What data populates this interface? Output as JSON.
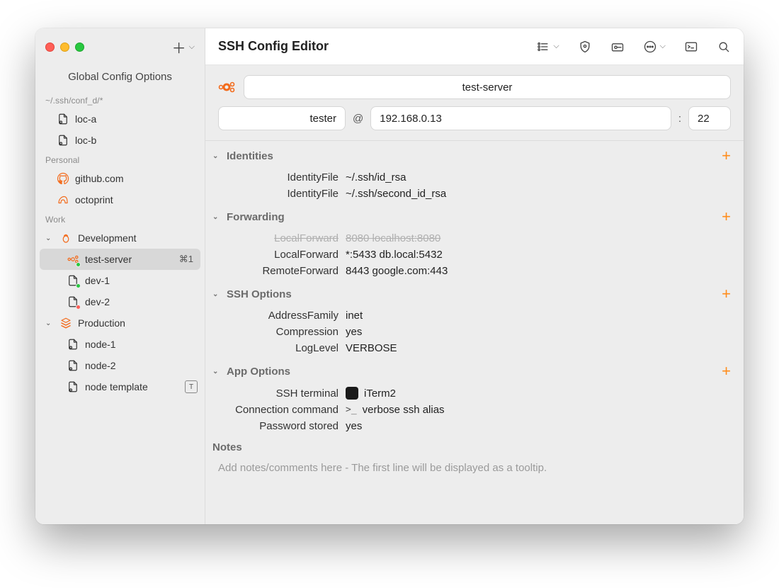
{
  "window": {
    "title": "SSH Config Editor"
  },
  "sidebar": {
    "title": "Global Config Options",
    "groups": [
      {
        "label": "~/.ssh/conf_d/*",
        "items": [
          {
            "label": "loc-a",
            "icon": "file-link"
          },
          {
            "label": "loc-b",
            "icon": "file-link"
          }
        ]
      },
      {
        "label": "Personal",
        "items": [
          {
            "label": "github.com",
            "icon": "github"
          },
          {
            "label": "octoprint",
            "icon": "octoprint"
          }
        ]
      },
      {
        "label": "Work",
        "items": [
          {
            "label": "Development",
            "icon": "bug-orange",
            "expanded": true,
            "children": [
              {
                "label": "test-server",
                "icon": "ubuntu-green",
                "selected": true,
                "shortcut": "⌘1"
              },
              {
                "label": "dev-1",
                "icon": "file-green"
              },
              {
                "label": "dev-2",
                "icon": "file-red"
              }
            ]
          },
          {
            "label": "Production",
            "icon": "stack-orange",
            "expanded": true,
            "children": [
              {
                "label": "node-1",
                "icon": "file-link"
              },
              {
                "label": "node-2",
                "icon": "file-link"
              },
              {
                "label": "node template",
                "icon": "file-link",
                "trailing_badge": "T"
              }
            ]
          }
        ]
      }
    ]
  },
  "host": {
    "name": "test-server",
    "os_icon": "ubuntu",
    "user": "tester",
    "address": "192.168.0.13",
    "port": "22"
  },
  "sections": {
    "identities": {
      "title": "Identities",
      "rows": [
        {
          "key": "IdentityFile",
          "value": "~/.ssh/id_rsa"
        },
        {
          "key": "IdentityFile",
          "value": "~/.ssh/second_id_rsa"
        }
      ]
    },
    "forwarding": {
      "title": "Forwarding",
      "rows": [
        {
          "key": "LocalForward",
          "value": "8080 localhost:8080",
          "disabled": true
        },
        {
          "key": "LocalForward",
          "value": "*:5433 db.local:5432"
        },
        {
          "key": "RemoteForward",
          "value": "8443 google.com:443"
        }
      ]
    },
    "ssh_options": {
      "title": "SSH Options",
      "rows": [
        {
          "key": "AddressFamily",
          "value": "inet"
        },
        {
          "key": "Compression",
          "value": "yes"
        },
        {
          "key": "LogLevel",
          "value": "VERBOSE"
        }
      ]
    },
    "app_options": {
      "title": "App Options",
      "rows": [
        {
          "key": "SSH terminal",
          "value": "iTerm2",
          "icon": "app"
        },
        {
          "key": "Connection command",
          "value": "verbose ssh alias",
          "icon": "prompt"
        },
        {
          "key": "Password stored",
          "value": "yes"
        }
      ]
    },
    "notes": {
      "title": "Notes",
      "placeholder": "Add notes/comments here - The first line will be displayed as a tooltip."
    }
  }
}
